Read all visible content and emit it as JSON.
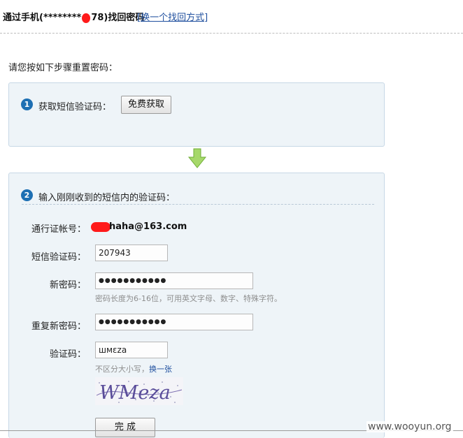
{
  "header": {
    "title_prefix": "通过手机(********",
    "title_suffix": "78)找回密码",
    "switch_link": "[换一个找回方式]"
  },
  "instruction": "请您按如下步骤重置密码：",
  "step1": {
    "number": "1",
    "label": "获取短信验证码：",
    "button": "免费获取"
  },
  "step2": {
    "number": "2",
    "label": "输入刚刚收到的短信内的验证码：",
    "account_label": "通行证帐号：",
    "account_value": "haha@163.com",
    "sms_label": "短信验证码：",
    "sms_value": "207943",
    "new_password_label": "新密码：",
    "new_password_value": "●●●●●●●●●●●",
    "password_hint": "密码长度为6-16位，可用英文字母、数字、特殊字符。",
    "repeat_password_label": "重复新密码：",
    "repeat_password_value": "●●●●●●●●●●●",
    "captcha_label": "验证码：",
    "captcha_value": "шмεzа",
    "captcha_hint": "不区分大小写，",
    "captcha_refresh": "换一张",
    "captcha_text": "WMeza",
    "submit": "完 成"
  },
  "watermark": "www.wooyun.org",
  "colors": {
    "link": "#1f4f9e",
    "box_bg": "#eef4f8",
    "step_num": "#1d6fb3",
    "redaction": "#ff1a1a"
  }
}
